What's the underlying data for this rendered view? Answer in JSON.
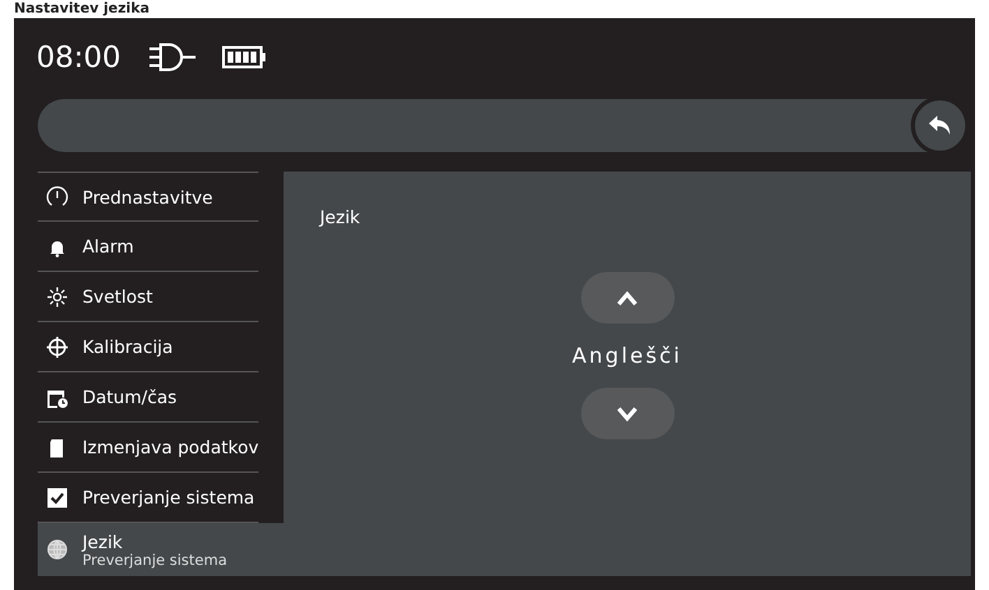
{
  "page_title": "Nastavitev jezika",
  "status": {
    "time": "08:00"
  },
  "menu": [
    {
      "kind": "gauge",
      "label": "Prednastavitve",
      "selected": false
    },
    {
      "kind": "bell",
      "label": "Alarm",
      "selected": false
    },
    {
      "kind": "sun",
      "label": "Svetlost",
      "selected": false
    },
    {
      "kind": "crosshair",
      "label": "Kalibracija",
      "selected": false
    },
    {
      "kind": "calendar",
      "label": "Datum/čas",
      "selected": false
    },
    {
      "kind": "card",
      "label": "Izmenjava podatkov",
      "selected": false
    },
    {
      "kind": "check",
      "label": "Preverjanje sistema",
      "selected": false
    },
    {
      "kind": "globe",
      "label": "Jezik",
      "sublabel": "Preverjanje sistema",
      "selected": true
    }
  ],
  "panel": {
    "title": "Jezik",
    "value": "Anglešči"
  }
}
